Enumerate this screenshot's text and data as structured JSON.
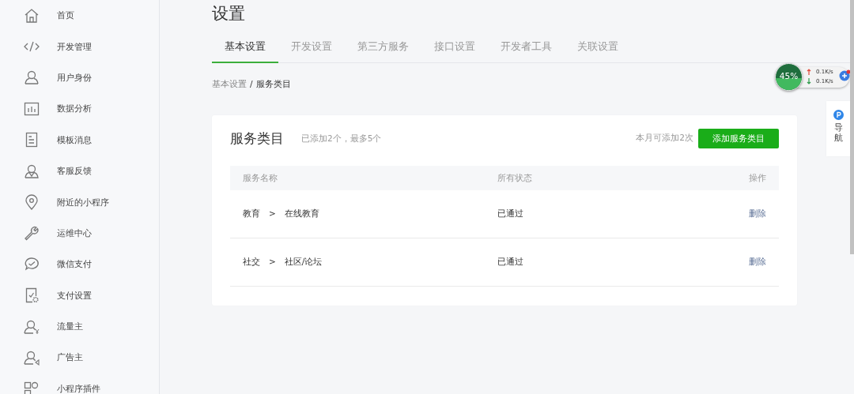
{
  "sidebar": {
    "items": [
      {
        "label": "首页"
      },
      {
        "label": "开发管理"
      },
      {
        "label": "用户身份"
      },
      {
        "label": "数据分析"
      },
      {
        "label": "模板消息"
      },
      {
        "label": "客服反馈"
      },
      {
        "label": "附近的小程序"
      },
      {
        "label": "运维中心"
      },
      {
        "label": "微信支付"
      },
      {
        "label": "支付设置"
      },
      {
        "label": "流量主"
      },
      {
        "label": "广告主"
      },
      {
        "label": "小程序插件"
      }
    ]
  },
  "page": {
    "title": "设置",
    "tabs": [
      {
        "label": "基本设置",
        "selected": true
      },
      {
        "label": "开发设置",
        "selected": false
      },
      {
        "label": "第三方服务",
        "selected": false
      },
      {
        "label": "接口设置",
        "selected": false
      },
      {
        "label": "开发者工具",
        "selected": false
      },
      {
        "label": "关联设置",
        "selected": false
      }
    ],
    "breadcrumb": [
      {
        "label": "基本设置",
        "current": false
      },
      {
        "label": "服务类目",
        "current": true
      }
    ],
    "breadcrumb_separator": "/",
    "card": {
      "title": "服务类目",
      "subtitle": "已添加2个，最多5个",
      "quota": "本月可添加2次",
      "add_button": "添加服务类目",
      "table": {
        "columns": [
          "服务名称",
          "所有状态",
          "操作"
        ],
        "rows": [
          {
            "category": "教育",
            "subcategory": "在线教育",
            "status": "已通过",
            "action": "删除"
          },
          {
            "category": "社交",
            "subcategory": "社区/论坛",
            "status": "已通过",
            "action": "删除"
          }
        ],
        "path_separator": ">"
      }
    }
  },
  "speed_widget": {
    "percent": "45%",
    "upload": "0.1K/s",
    "download": "0.1K/s"
  },
  "side_nav": {
    "label": "导航"
  }
}
